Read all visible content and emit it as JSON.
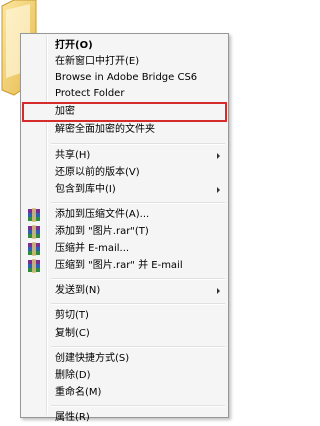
{
  "desktop": {
    "icon": "folder-icon"
  },
  "menu": {
    "items": [
      {
        "label": "打开(O)",
        "bold": true
      },
      {
        "label": "在新窗口中打开(E)"
      },
      {
        "label": "Browse in Adobe Bridge CS6"
      },
      {
        "label": "Protect Folder"
      },
      {
        "label": "加密",
        "highlight": true
      },
      {
        "label": "解密全面加密的文件夹"
      },
      {
        "label": "共享(H)",
        "submenu": true
      },
      {
        "label": "还原以前的版本(V)"
      },
      {
        "label": "包含到库中(I)",
        "submenu": true
      },
      {
        "label": "添加到压缩文件(A)...",
        "icon": "winrar-archive-icon"
      },
      {
        "label": "添加到 \"图片.rar\"(T)",
        "icon": "winrar-archive-icon"
      },
      {
        "label": "压缩并 E-mail...",
        "icon": "winrar-archive-icon"
      },
      {
        "label": "压缩到 \"图片.rar\" 并 E-mail",
        "icon": "winrar-archive-icon"
      },
      {
        "label": "发送到(N)",
        "submenu": true
      },
      {
        "label": "剪切(T)"
      },
      {
        "label": "复制(C)"
      },
      {
        "label": "创建快捷方式(S)"
      },
      {
        "label": "删除(D)"
      },
      {
        "label": "重命名(M)"
      },
      {
        "label": "属性(R)"
      }
    ]
  },
  "colors": {
    "highlight_box": "#d62b2b",
    "menu_bg": "#f5f5f5"
  }
}
